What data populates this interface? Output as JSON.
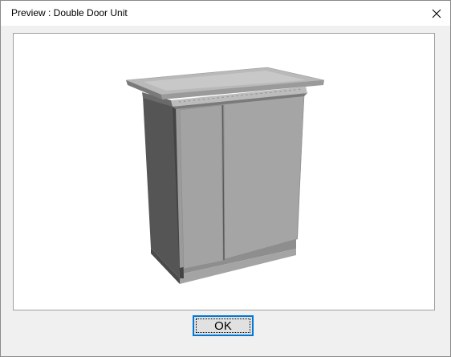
{
  "window": {
    "title": "Preview : Double Door Unit"
  },
  "titlebar": {
    "close_icon": "close-icon"
  },
  "footer": {
    "ok_label": "OK"
  },
  "colors": {
    "accent": "#0078d7",
    "model_light": "#a8a8a8",
    "model_dark": "#4d4d4d"
  }
}
